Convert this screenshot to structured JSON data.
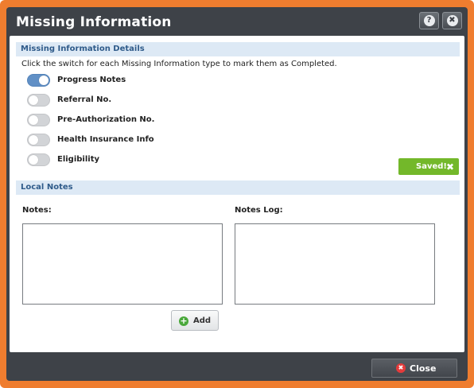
{
  "dialog": {
    "title": "Missing Information",
    "help_glyph": "?",
    "close_glyph": "✖",
    "icons": {
      "help": "help-icon",
      "close": "close-icon"
    }
  },
  "details": {
    "header": "Missing Information Details",
    "hint": "Click the switch for each Missing Information type to mark them as Completed.",
    "items": [
      {
        "label": "Progress Notes",
        "on": true
      },
      {
        "label": "Referral No.",
        "on": false
      },
      {
        "label": "Pre-Authorization No.",
        "on": false
      },
      {
        "label": "Health Insurance Info",
        "on": false
      },
      {
        "label": "Eligibility",
        "on": false
      }
    ],
    "saved_badge": {
      "text": "Saved!",
      "dismiss_glyph": "✖"
    }
  },
  "local_notes": {
    "header": "Local Notes",
    "notes_label": "Notes:",
    "notes_value": "",
    "log_label": "Notes Log:",
    "log_value": "",
    "add_label": "Add",
    "add_glyph": "+"
  },
  "footer": {
    "close_label": "Close",
    "close_glyph": "✖"
  },
  "colors": {
    "frame": "#ef7d2f",
    "dialog_bg": "#3e4248",
    "section_header_bg": "#dde9f5",
    "toggle_on": "#6190c6",
    "saved_green": "#73b82a"
  }
}
